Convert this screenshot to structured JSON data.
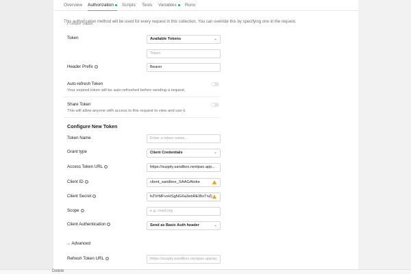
{
  "tabs": [
    {
      "label": "Overview",
      "active": false,
      "dot": false
    },
    {
      "label": "Authorization",
      "active": true,
      "dot": true
    },
    {
      "label": "Scripts",
      "active": false,
      "dot": false
    },
    {
      "label": "Tests",
      "active": false,
      "dot": false
    },
    {
      "label": "Variables",
      "active": false,
      "dot": true
    },
    {
      "label": "Runs",
      "active": false,
      "dot": false
    }
  ],
  "status_dot_color": "#0cbb52",
  "accent_color": "#ff6c37",
  "description": "This authorization method will be used for every request in this collection. You can override this by specifying one in the request.",
  "current_token": {
    "heading": "Current Token",
    "token_label": "Token",
    "token_select": "Available Tokens",
    "token_input_placeholder": "Token",
    "header_prefix_label": "Header Prefix",
    "header_prefix_value": "Bearer",
    "auto_refresh_label": "Auto-refresh Token",
    "auto_refresh_desc": "Your expired token will be auto-refreshed before sending a request.",
    "auto_refresh_on": false,
    "share_label": "Share Token",
    "share_desc": "This will allow anyone with access to this request to view and use it.",
    "share_on": false
  },
  "new_token": {
    "title": "Configure New Token",
    "token_name_label": "Token Name",
    "token_name_placeholder": "Enter a token name...",
    "grant_type_label": "Grant type",
    "grant_type_value": "Client Credentials",
    "access_token_url_label": "Access Token URL",
    "access_token_url_value": "https://supply.sandbox.nextpax.app...",
    "client_id_label": "Client ID",
    "client_id_value": "client_sandbox_SAAGAtoke",
    "client_secret_label": "Client Secret",
    "client_secret_value": "hZVrMFvxHSgNG6a3ebREIBxTnZj",
    "scope_label": "Scope",
    "scope_placeholder": "e.g. read:org",
    "client_auth_label": "Client Authentication",
    "client_auth_value": "Send as Basic Auth header",
    "advanced_label": "Advanced",
    "refresh_token_url_label": "Refresh Token URL",
    "refresh_token_url_placeholder": "https://supply.sandbox.nextpax.app/ac"
  },
  "footer_text": "Delete"
}
